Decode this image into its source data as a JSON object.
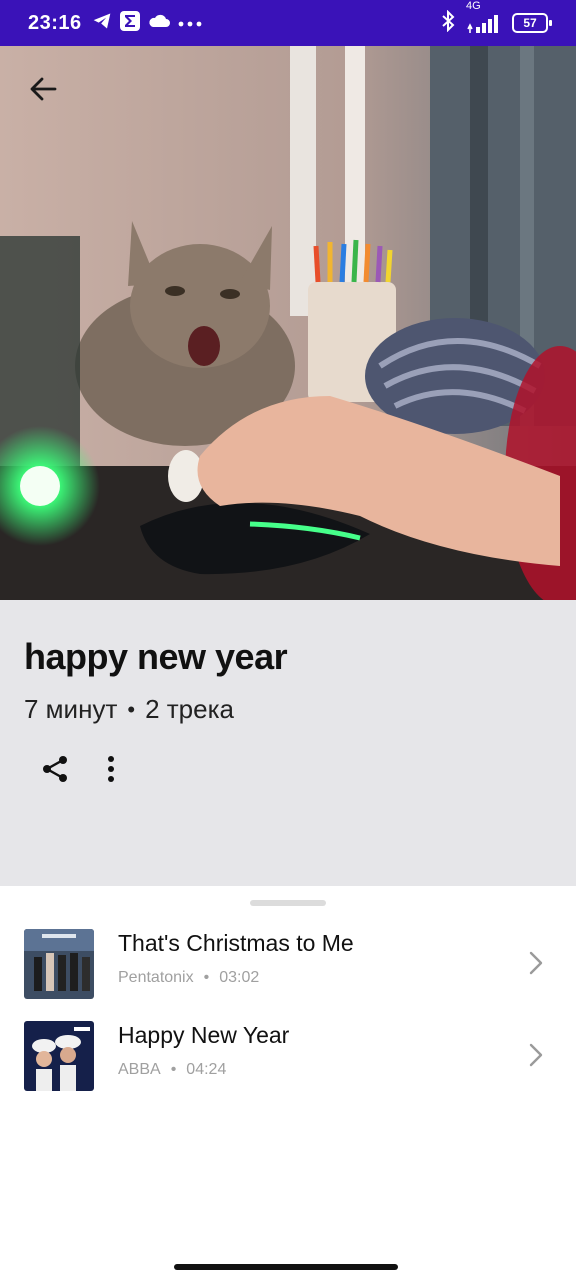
{
  "status": {
    "time": "23:16",
    "network_label": "4G",
    "battery": "57",
    "icons": [
      "telegram-icon",
      "sigma-icon",
      "cloud-icon",
      "more-dots-icon",
      "bluetooth-icon",
      "signal-icon",
      "battery-icon"
    ]
  },
  "header": {
    "back_icon": "back-arrow-icon"
  },
  "playlist": {
    "title": "happy new year",
    "duration": "7 минут",
    "separator": "•",
    "tracks_count": "2 трека",
    "actions": [
      {
        "name": "share-icon"
      },
      {
        "name": "more-vertical-icon"
      }
    ]
  },
  "tracks": [
    {
      "title": "That's Christmas to Me",
      "artist": "Pentatonix",
      "duration": "03:02"
    },
    {
      "title": "Happy New Year",
      "artist": "ABBA",
      "duration": "04:24"
    }
  ],
  "colors": {
    "status_bar": "#3a12b8",
    "info_bg": "#e6e6e9",
    "sheet_bg": "#ffffff",
    "subtle_text": "#a0a0a0"
  }
}
